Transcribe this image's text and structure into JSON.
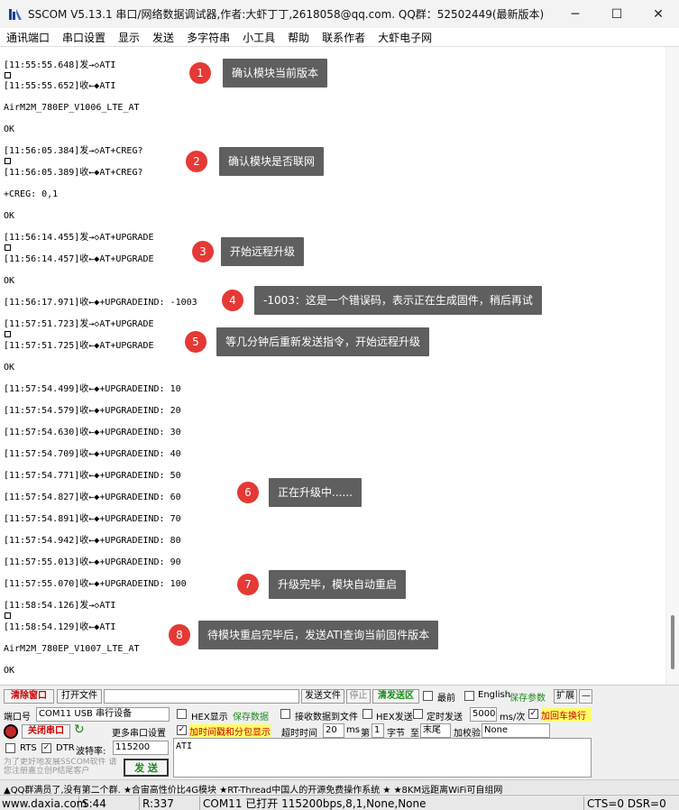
{
  "window": {
    "title": "SSCOM V5.13.1 串口/网络数据调试器,作者:大虾丁丁,2618058@qq.com. QQ群：52502449(最新版本)",
    "minimize": "─",
    "maximize": "☐",
    "close": "✕"
  },
  "menu": [
    "通讯端口",
    "串口设置",
    "显示",
    "发送",
    "多字符串",
    "小工具",
    "帮助",
    "联系作者",
    "大虾电子网"
  ],
  "log": [
    "[11:55:55.648]发→◇ATI",
    "[11:55:55.652]收←◆ATI",
    "AirM2M_780EP_V1006_LTE_AT",
    "OK",
    "[11:56:05.384]发→◇AT+CREG?",
    "[11:56:05.389]收←◆AT+CREG?",
    "+CREG: 0,1",
    "OK",
    "[11:56:14.455]发→◇AT+UPGRADE",
    "[11:56:14.457]收←◆AT+UPGRADE",
    "OK",
    "[11:56:17.971]收←◆+UPGRADEIND: -1003",
    "[11:57:51.723]发→◇AT+UPGRADE",
    "[11:57:51.725]收←◆AT+UPGRADE",
    "OK",
    "[11:57:54.499]收←◆+UPGRADEIND: 10",
    "[11:57:54.579]收←◆+UPGRADEIND: 20",
    "[11:57:54.630]收←◆+UPGRADEIND: 30",
    "[11:57:54.709]收←◆+UPGRADEIND: 40",
    "[11:57:54.771]收←◆+UPGRADEIND: 50",
    "[11:57:54.827]收←◆+UPGRADEIND: 60",
    "[11:57:54.891]收←◆+UPGRADEIND: 70",
    "[11:57:54.942]收←◆+UPGRADEIND: 80",
    "[11:57:55.013]收←◆+UPGRADEIND: 90",
    "[11:57:55.070]收←◆+UPGRADEIND: 100",
    "[11:58:54.126]发→◇ATI",
    "[11:58:54.129]收←◆ATI",
    "AirM2M_780EP_V1007_LTE_AT",
    "OK"
  ],
  "annotations": [
    {
      "num": "1",
      "text": "确认模块当前版本"
    },
    {
      "num": "2",
      "text": "确认模块是否联网"
    },
    {
      "num": "3",
      "text": "开始远程升级"
    },
    {
      "num": "4",
      "text": "-1003：这是一个错误码，表示正在生成固件，稍后再试"
    },
    {
      "num": "5",
      "text": "等几分钟后重新发送指令，开始远程升级"
    },
    {
      "num": "6",
      "text": "正在升级中......"
    },
    {
      "num": "7",
      "text": "升级完毕，模块自动重启"
    },
    {
      "num": "8",
      "text": "待模块重启完毕后，发送ATI查询当前固件版本"
    }
  ],
  "toolbar": {
    "clear_window": "清除窗口",
    "open_file": "打开文件",
    "send_file": "发送文件",
    "stop": "停止",
    "clear_send": "清发送区",
    "topmost": "最前",
    "english": "English",
    "save_params": "保存参数",
    "expand": "扩展",
    "collapse": "—"
  },
  "port": {
    "label": "端口号",
    "value": "COM11 USB 串行设备",
    "close_port": "关闭串口",
    "more_settings": "更多串口设置",
    "rts": "RTS",
    "dtr": "DTR",
    "baud_label": "波特率:",
    "baud": "115200"
  },
  "options": {
    "hex_display": "HEX显示",
    "save_data": "保存数据",
    "recv_to_file": "接收数据到文件",
    "hex_send": "HEX发送",
    "timed_send": "定时发送",
    "interval": "5000",
    "interval_unit": "ms/次",
    "add_crlf": "加回车换行",
    "timestamp": "加时间戳和分包显示",
    "timeout_label": "超时时间",
    "timeout": "20",
    "ms": "ms",
    "nth_label": "第",
    "nth": "1",
    "byte_label": "字节",
    "to_label": "至",
    "to_value": "末尾",
    "checksum_label": "加校验",
    "checksum": "None"
  },
  "send": {
    "text": "ATI",
    "send_button": "发 送",
    "promo": "为了更好地发展SSCOM软件 请您注册嘉立创P结尾客户"
  },
  "ticker": "▲QQ群满员了,没有第二个群.     ★合宙高性价比4G模块     ★RT-Thread中国人的开源免费操作系统     ★ ★8KM远距离WiFi可自组网",
  "status": {
    "site": "www.daxia.com",
    "sent": "S:44",
    "recv": "R:337",
    "port_state": "COM11 已打开  115200bps,8,1,None,None",
    "lines": "CTS=0 DSR=0"
  }
}
